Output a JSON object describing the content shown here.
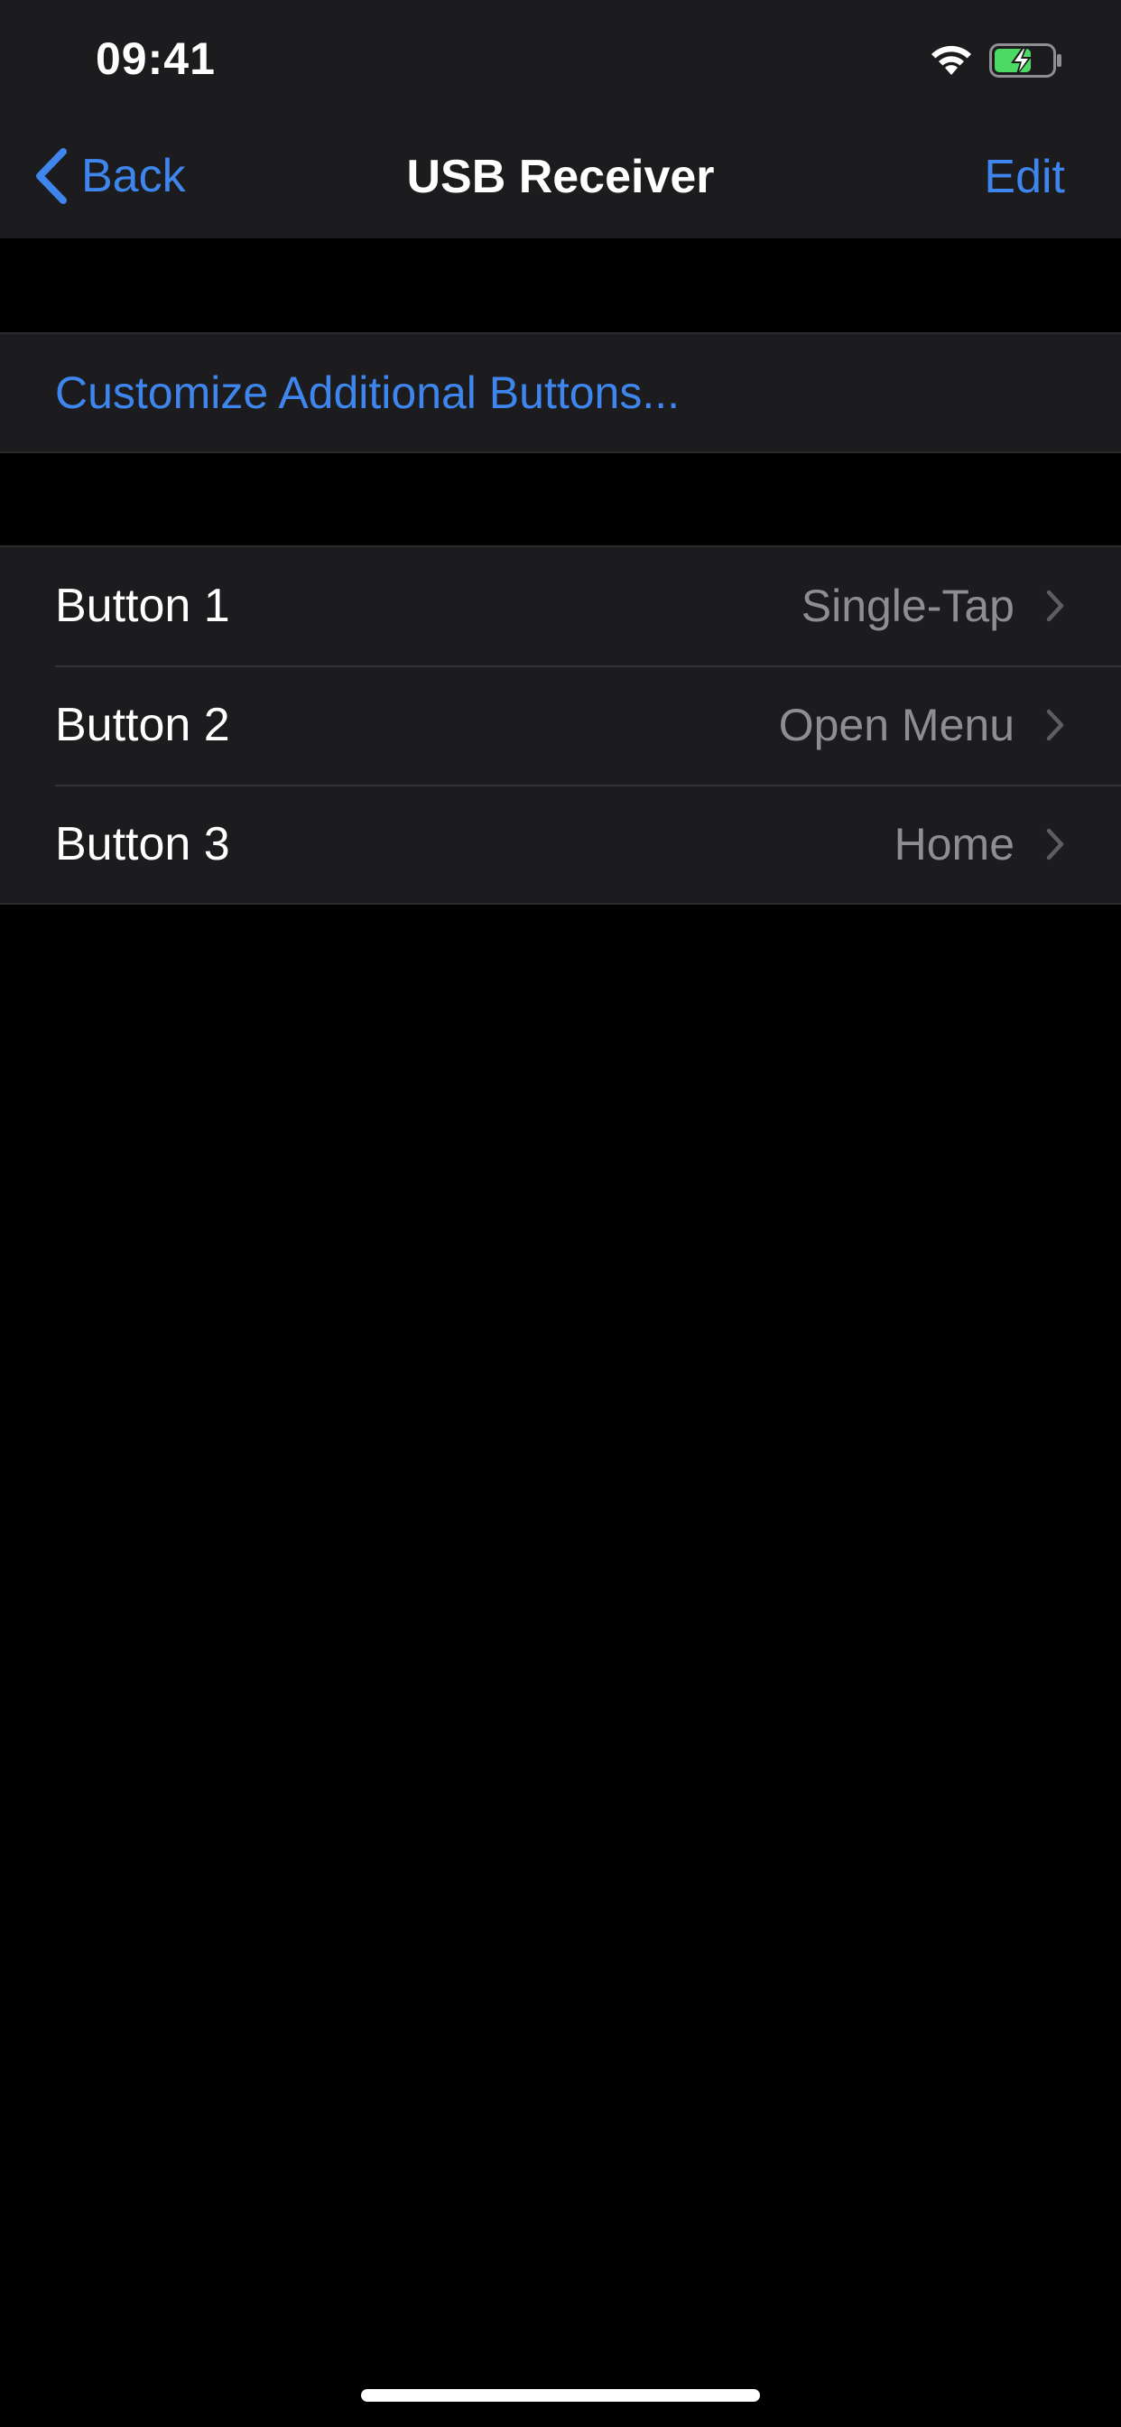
{
  "status_bar": {
    "time": "09:41",
    "wifi_icon": "wifi-icon",
    "battery_icon": "battery-charging-icon"
  },
  "nav": {
    "back_label": "Back",
    "title": "USB Receiver",
    "edit_label": "Edit"
  },
  "customize": {
    "label": "Customize Additional Buttons..."
  },
  "buttons": [
    {
      "label": "Button 1",
      "value": "Single-Tap"
    },
    {
      "label": "Button 2",
      "value": "Open Menu"
    },
    {
      "label": "Button 3",
      "value": "Home"
    }
  ],
  "colors": {
    "accent": "#3e86ee",
    "background": "#000000",
    "cell": "#1c1c1e",
    "secondary_text": "#8d8d93",
    "battery_fill": "#4cd964"
  }
}
